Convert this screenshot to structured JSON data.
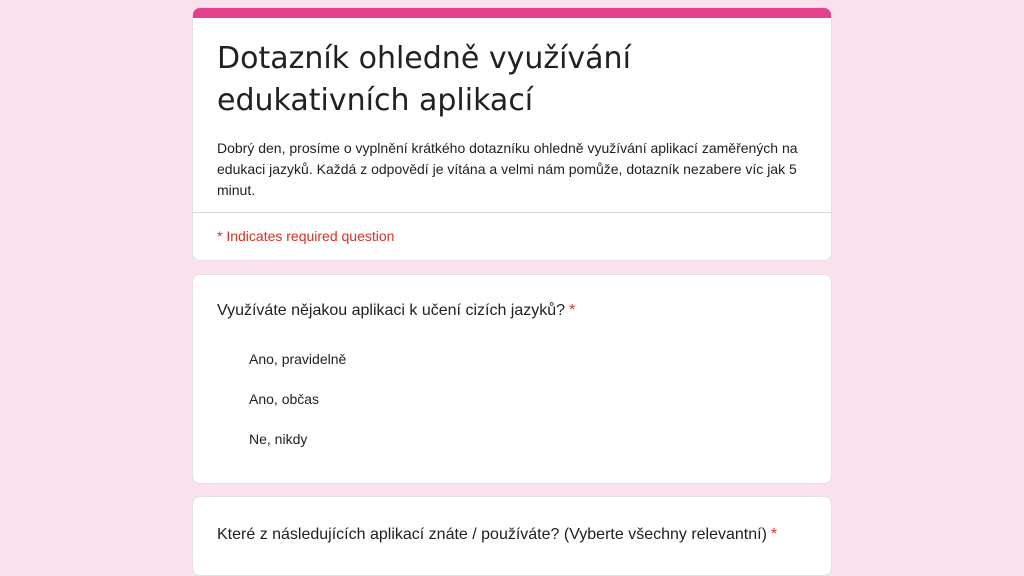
{
  "form": {
    "title": "Dotazník ohledně využívání edukativních aplikací",
    "description": "Dobrý den, prosíme o vyplnění krátkého dotazníku ohledně využívání aplikací zaměřených na edukaci jazyků. Každá z odpovědí je vítána a velmi nám pomůže, dotazník nezabere víc jak 5 minut.",
    "required_note": "* Indicates required question",
    "accent_color": "#e4418d",
    "background_color": "#f9e1ee"
  },
  "questions": [
    {
      "text": "Využíváte nějakou aplikaci k učení cizích jazyků?",
      "required_mark": "*",
      "options": [
        "Ano, pravidelně",
        "Ano, občas",
        "Ne, nikdy"
      ]
    },
    {
      "text": "Které z následujících aplikací znáte / používáte? (Vyberte všechny relevantní)",
      "required_mark": "*"
    }
  ]
}
